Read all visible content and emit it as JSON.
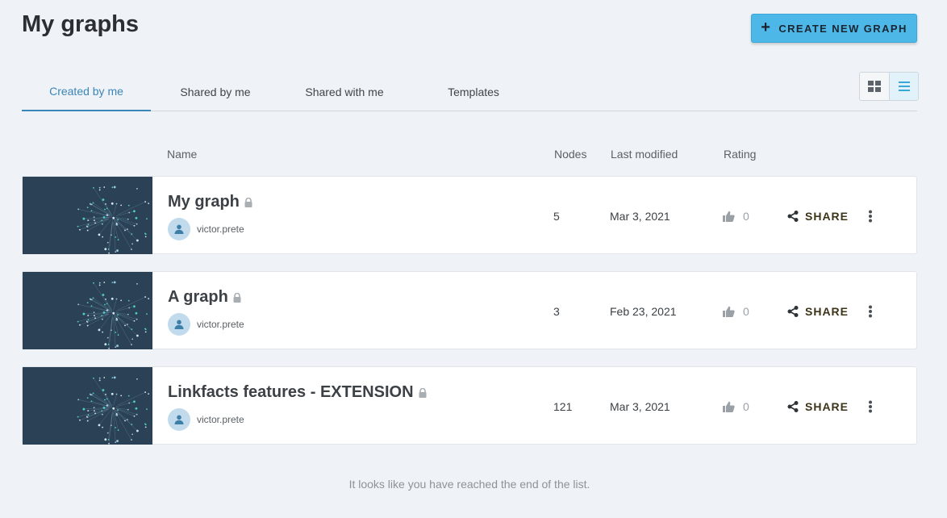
{
  "page_title": "My graphs",
  "create_button_label": "CREATE NEW GRAPH",
  "tabs": [
    {
      "label": "Created by me",
      "active": true
    },
    {
      "label": "Shared by me",
      "active": false
    },
    {
      "label": "Shared with me",
      "active": false
    },
    {
      "label": "Templates",
      "active": false
    }
  ],
  "view_toggle": {
    "options": [
      "grid-view-icon",
      "list-view-icon"
    ],
    "selected": "list"
  },
  "columns": {
    "name": "Name",
    "nodes": "Nodes",
    "last_modified": "Last modified",
    "rating": "Rating"
  },
  "graphs": [
    {
      "name": "My graph",
      "owner": "victor.prete",
      "nodes": "5",
      "last_modified": "Mar 3, 2021",
      "rating": "0",
      "share_label": "SHARE",
      "locked": true
    },
    {
      "name": "A graph",
      "owner": "victor.prete",
      "nodes": "3",
      "last_modified": "Feb 23, 2021",
      "rating": "0",
      "share_label": "SHARE",
      "locked": true
    },
    {
      "name": "Linkfacts features - EXTENSION",
      "owner": "victor.prete",
      "nodes": "121",
      "last_modified": "Mar 3, 2021",
      "rating": "0",
      "share_label": "SHARE",
      "locked": true
    }
  ],
  "end_message": "It looks like you have reached the end of the list.",
  "colors": {
    "accent": "#3b86b8",
    "button": "#4db8e8",
    "thumbnail_bg": "#2b4256",
    "background": "#eff2f6"
  }
}
